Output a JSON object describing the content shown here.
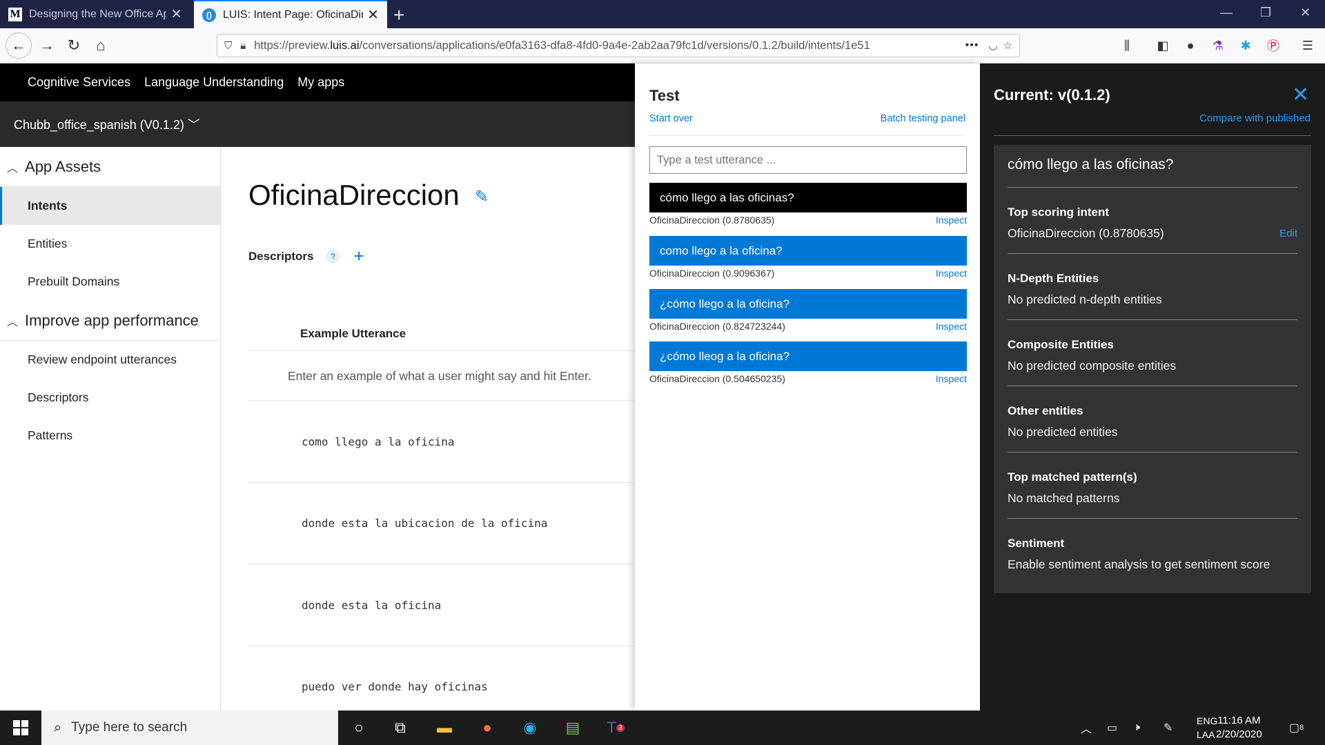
{
  "browser": {
    "tabs": [
      {
        "favicon": "M",
        "title": "Designing the New Office App"
      },
      {
        "favicon": "L",
        "title": "LUIS: Intent Page: OficinaDireccion"
      }
    ],
    "url_prefix": "https://preview.",
    "url_domain": "luis.ai",
    "url_rest": "/conversations/applications/e0fa3163-dfa8-4fd0-9a4e-2ab2aa79fc1d/versions/0.1.2/build/intents/1e51",
    "more_label": "•••"
  },
  "topnav": {
    "items": [
      "Cognitive Services",
      "Language Understanding",
      "My apps"
    ]
  },
  "app": {
    "name": "Chubb_office_spanish (V0.1.2)"
  },
  "sidebar": {
    "sections": [
      {
        "title": "App Assets",
        "items": [
          "Intents",
          "Entities",
          "Prebuilt Domains"
        ]
      },
      {
        "title": "Improve app performance",
        "items": [
          "Review endpoint utterances",
          "Descriptors",
          "Patterns"
        ]
      }
    ]
  },
  "main": {
    "intent_name": "OficinaDireccion",
    "descriptors_label": "Descriptors",
    "column_header": "Example Utterance",
    "input_hint": "Enter an example of what a user might say and hit Enter.",
    "utterances": [
      "como llego a la oficina",
      "donde esta la ubicacion de la oficina",
      "donde esta la oficina",
      "puedo ver donde hay oficinas"
    ]
  },
  "test_panel": {
    "title": "Test",
    "start_over": "Start over",
    "batch_testing": "Batch testing panel",
    "input_placeholder": "Type a test utterance ...",
    "inspect_label": "Inspect",
    "results": [
      {
        "text": "cómo llego a las oficinas?",
        "score": "OficinaDireccion (0.8780635)"
      },
      {
        "text": "como llego a la oficina?",
        "score": "OficinaDireccion (0.9096367)"
      },
      {
        "text": "¿cómo llego a la oficina?",
        "score": "OficinaDireccion (0.824723244)"
      },
      {
        "text": "¿cómo lleog a la oficina?",
        "score": "OficinaDireccion (0.504650235)"
      }
    ]
  },
  "inspect_panel": {
    "title": "Current: v(0.1.2)",
    "compare_link": "Compare with published",
    "utterance": "cómo llego a las oficinas?",
    "edit_label": "Edit",
    "sections": [
      {
        "heading": "Top scoring intent",
        "value": "OficinaDireccion (0.8780635)"
      },
      {
        "heading": "N-Depth Entities",
        "value": "No predicted n-depth entities"
      },
      {
        "heading": "Composite Entities",
        "value": "No predicted composite entities"
      },
      {
        "heading": "Other entities",
        "value": "No predicted entities"
      },
      {
        "heading": "Top matched pattern(s)",
        "value": "No matched patterns"
      },
      {
        "heading": "Sentiment",
        "value": "Enable sentiment analysis to get sentiment score"
      }
    ]
  },
  "taskbar": {
    "search_placeholder": "Type here to search",
    "language_line1": "ENG",
    "language_line2": "LAA",
    "time": "11:16 AM",
    "date": "2/20/2020",
    "notification_count": "8",
    "teams_badge": "3"
  },
  "colors": {
    "accent": "#0078d4",
    "tab_strip": "#1f2447",
    "header_black": "#000000",
    "app_bar": "#2b2b2b",
    "inspect_bg": "#1b1b1b",
    "inspect_box": "#333333"
  }
}
